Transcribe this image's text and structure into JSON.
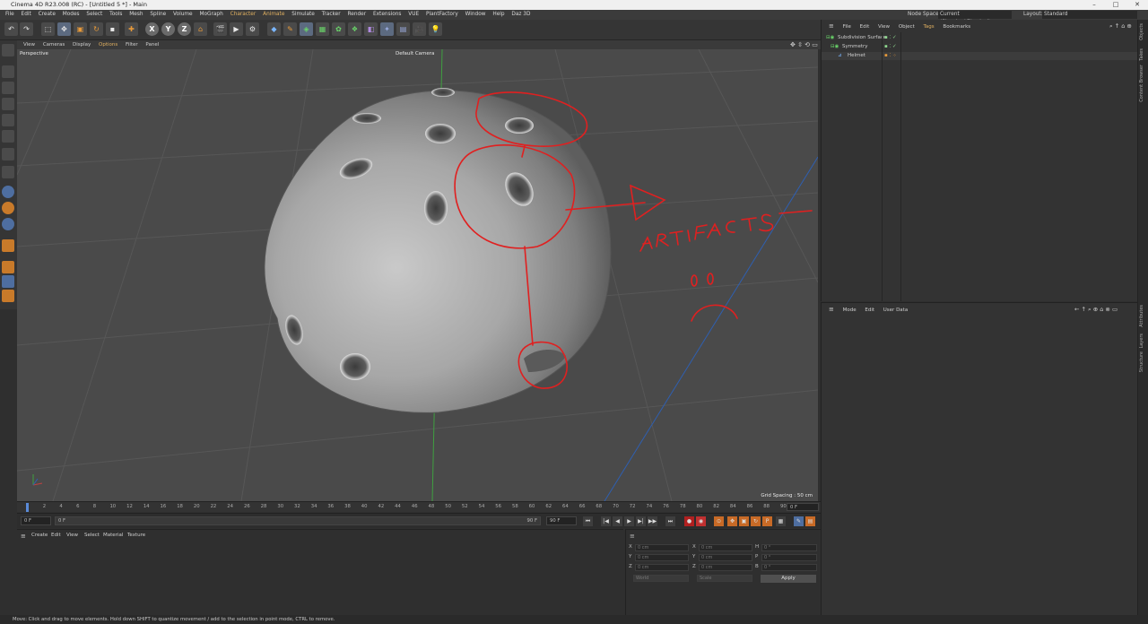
{
  "window": {
    "title": "Cinema 4D R23.008 (RC) - [Untitled 5 *] - Main"
  },
  "menubar": {
    "items": [
      "File",
      "Edit",
      "Create",
      "Modes",
      "Select",
      "Tools",
      "Mesh",
      "Spline",
      "Volume",
      "MoGraph",
      "Character",
      "Animate",
      "Simulate",
      "Tracker",
      "Render",
      "Extensions",
      "VUE",
      "PlantFactory",
      "Window",
      "Help",
      "Daz 3D"
    ],
    "node_space_label": "Node Space:",
    "node_space_value": "Current (Standard/Physical)",
    "layout_label": "Layout:",
    "layout_value": "Standard"
  },
  "toolbar": {
    "axis_x": "X",
    "axis_y": "Y",
    "axis_z": "Z"
  },
  "viewport_menu": {
    "items": [
      "View",
      "Cameras",
      "Display",
      "Options",
      "Filter",
      "Panel"
    ]
  },
  "viewport": {
    "view_name": "Perspective",
    "camera": "Default Camera",
    "grid_spacing": "Grid Spacing : 50 cm",
    "annotation_text": "ARTIFACTS",
    "colors": {
      "background": "#4a4a4a",
      "grid": "#565656",
      "y_axis": "#3fa040",
      "z_axis": "#2f5fb0",
      "annotation": "#e02020"
    }
  },
  "timeline": {
    "ticks": [
      "0",
      "2",
      "4",
      "6",
      "8",
      "10",
      "12",
      "14",
      "16",
      "18",
      "20",
      "22",
      "24",
      "26",
      "28",
      "30",
      "32",
      "34",
      "36",
      "38",
      "40",
      "42",
      "44",
      "46",
      "48",
      "50",
      "52",
      "54",
      "56",
      "58",
      "60",
      "62",
      "64",
      "66",
      "68",
      "70",
      "72",
      "74",
      "76",
      "78",
      "80",
      "82",
      "84",
      "86",
      "88",
      "90"
    ],
    "current_frame_field": "0 F",
    "start_field": "0 F",
    "range_start": "0 F",
    "range_end": "90 F",
    "end_field": "90 F"
  },
  "material_menu": {
    "items": [
      "Create",
      "Edit",
      "View",
      "Select",
      "Material",
      "Texture"
    ]
  },
  "coords": {
    "labels_left": [
      "X",
      "Y",
      "Z"
    ],
    "labels_mid": [
      "X",
      "Y",
      "Z"
    ],
    "labels_right": [
      "H",
      "P",
      "B"
    ],
    "pos_values": [
      "0 cm",
      "0 cm",
      "0 cm"
    ],
    "size_values": [
      "0 cm",
      "0 cm",
      "0 cm"
    ],
    "rot_values": [
      "0 °",
      "0 °",
      "0 °"
    ],
    "mode_dropdown": "World",
    "scale_dropdown": "Scale",
    "apply_label": "Apply"
  },
  "object_manager": {
    "menu": [
      "File",
      "Edit",
      "View",
      "Object",
      "Tags",
      "Bookmarks"
    ],
    "objects": [
      {
        "name": "Subdivision Surface"
      },
      {
        "name": "Symmetry"
      },
      {
        "name": "Helmet"
      }
    ]
  },
  "attributes": {
    "menu": [
      "Mode",
      "Edit",
      "User Data"
    ]
  },
  "right_tabs": {
    "top": [
      "Objects",
      "Takes",
      "Content Browser"
    ],
    "bottom": [
      "Attributes",
      "Layers",
      "Structure"
    ]
  },
  "status": {
    "text": "Move: Click and drag to move elements. Hold down SHIFT to quantize movement / add to the selection in point mode, CTRL to remove."
  }
}
